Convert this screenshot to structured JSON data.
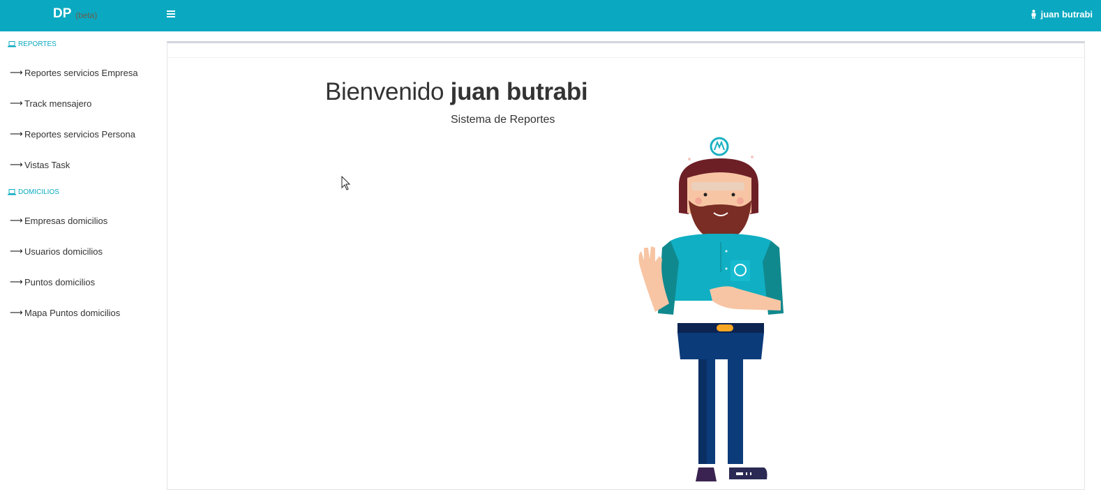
{
  "brand": {
    "title": "DP",
    "badge": "(beta)"
  },
  "header": {
    "user_name": "juan butrabi"
  },
  "sidebar": {
    "sections": [
      {
        "title": "REPORTES",
        "items": [
          "Reportes servicios Empresa",
          "Track mensajero",
          "Reportes servicios Persona",
          "Vistas Task"
        ]
      },
      {
        "title": "DOMICILIOS",
        "items": [
          "Empresas domicilios",
          "Usuarios domicilios",
          "Puntos domicilios",
          "Mapa Puntos domicilios"
        ]
      }
    ]
  },
  "main": {
    "welcome_prefix": "Bienvenido",
    "welcome_name": "juan butrabi",
    "subtitle": "Sistema de Reportes"
  },
  "colors": {
    "accent": "#0aa9c1",
    "text": "#333333"
  },
  "icons": {
    "menu": "hamburger-icon",
    "user": "user-icon",
    "section": "laptop-icon",
    "item": "arrow-right-icon"
  }
}
